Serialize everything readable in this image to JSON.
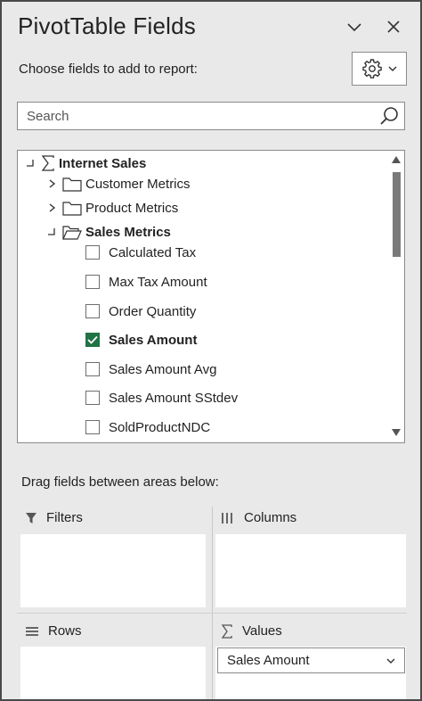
{
  "panel": {
    "title": "PivotTable Fields",
    "choose_label": "Choose fields to add to report:",
    "accent_color": "#217346"
  },
  "search": {
    "placeholder": "Search"
  },
  "tree": {
    "root": {
      "label": "Internet Sales",
      "icon": "sigma-icon",
      "expanded": true
    },
    "folders": [
      {
        "label": "Customer Metrics",
        "expanded": false
      },
      {
        "label": "Product Metrics",
        "expanded": false
      },
      {
        "label": "Sales Metrics",
        "expanded": true
      }
    ],
    "fields": [
      {
        "label": "Calculated Tax",
        "checked": false
      },
      {
        "label": "Max Tax Amount",
        "checked": false
      },
      {
        "label": "Order Quantity",
        "checked": false
      },
      {
        "label": "Sales Amount",
        "checked": true
      },
      {
        "label": "Sales Amount Avg",
        "checked": false
      },
      {
        "label": "Sales Amount SStdev",
        "checked": false
      },
      {
        "label": "SoldProductNDC",
        "checked": false
      }
    ]
  },
  "areas": {
    "drag_label": "Drag fields between areas below:",
    "filters": "Filters",
    "columns": "Columns",
    "rows": "Rows",
    "values": "Values",
    "values_items": [
      "Sales Amount"
    ]
  }
}
